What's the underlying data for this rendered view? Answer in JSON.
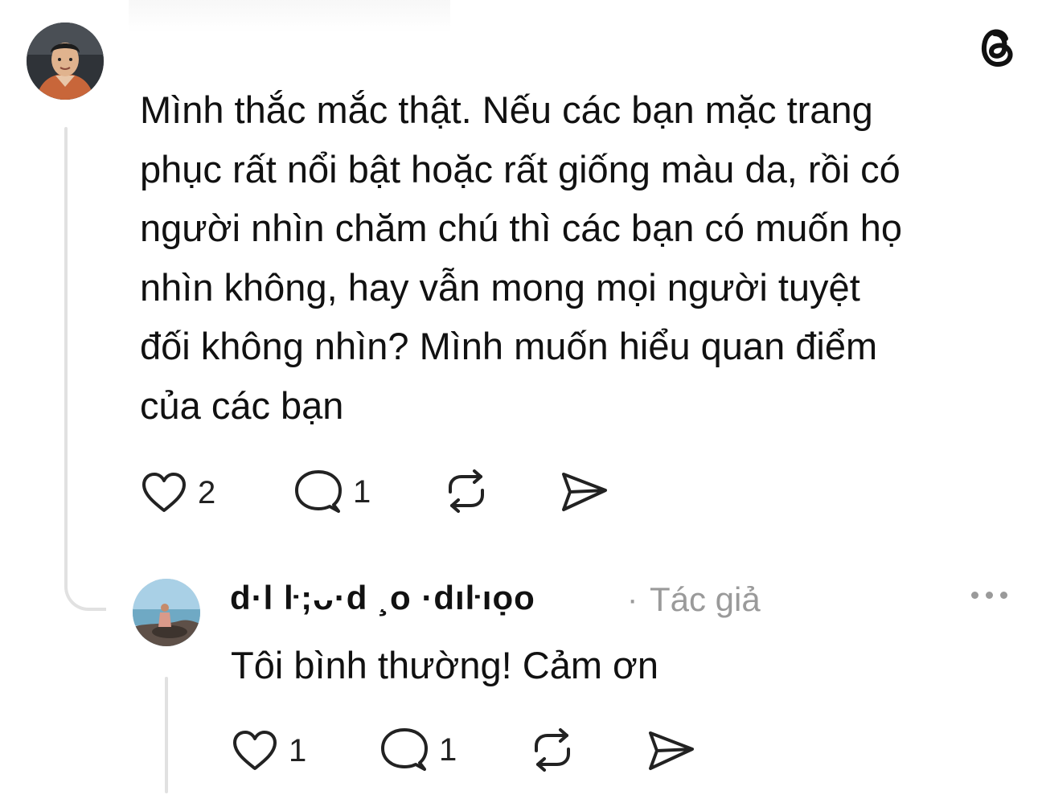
{
  "post": {
    "text": "Mình thắc mắc thật. Nếu các bạn mặc trang\nphục rất nổi bật hoặc rất giống màu da, rồi có\nngười nhìn chăm chú thì các bạn có muốn họ\nnhìn không, hay vẫn mong mọi người tuyệt\nđối không nhìn? Mình muốn hiểu quan điểm\ncủa các bạn",
    "likes": "2",
    "comments": "1"
  },
  "reply": {
    "username": "d·l ŀ;ᴗ·d ¸o ·dıŀıọo",
    "separator": "·",
    "author_badge": "Tác giả",
    "text": "Tôi bình thường! Cảm ơn",
    "likes": "1",
    "comments": "1"
  },
  "icons": {
    "brand": "threads-logo-icon",
    "like": "heart-icon",
    "comment": "comment-bubble-icon",
    "repost": "repost-icon",
    "share": "send-icon",
    "more": "more-options-icon"
  }
}
